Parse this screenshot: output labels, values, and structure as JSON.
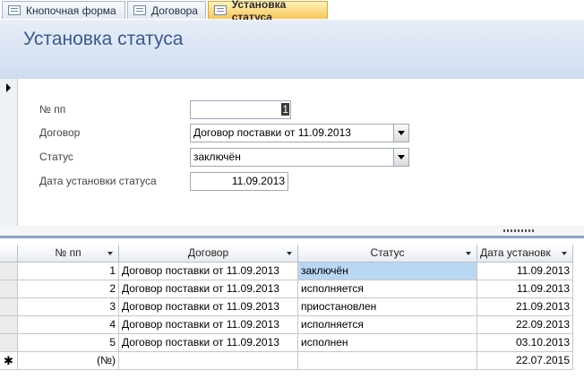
{
  "tabs": [
    {
      "label": "Кнопочная форма"
    },
    {
      "label": "Договора"
    },
    {
      "label": "Установка статуса"
    }
  ],
  "header": {
    "title": "Установка статуса"
  },
  "form": {
    "num_label": "№ пп",
    "num_value": "1",
    "contract_label": "Договор",
    "contract_value": "Договор поставки от 11.09.2013",
    "status_label": "Статус",
    "status_value": "заключён",
    "date_label": "Дата установки статуса",
    "date_value": "11.09.2013"
  },
  "table": {
    "columns": [
      "№ пп",
      "Договор",
      "Статус",
      "Дата установк"
    ],
    "rows": [
      {
        "num": "1",
        "contract": "Договор поставки от 11.09.2013",
        "status": "заключён",
        "date": "11.09.2013"
      },
      {
        "num": "2",
        "contract": "Договор поставки от 11.09.2013",
        "status": "исполняется",
        "date": "11.09.2013"
      },
      {
        "num": "3",
        "contract": "Договор поставки от 11.09.2013",
        "status": "приостановлен",
        "date": "21.09.2013"
      },
      {
        "num": "4",
        "contract": "Договор поставки от 11.09.2013",
        "status": "исполняется",
        "date": "22.09.2013"
      },
      {
        "num": "5",
        "contract": "Договор поставки от 11.09.2013",
        "status": "исполнен",
        "date": "03.10.2013"
      }
    ],
    "new_row": {
      "num": "(№)",
      "date": "22.07.2015",
      "marker": "✱"
    }
  }
}
